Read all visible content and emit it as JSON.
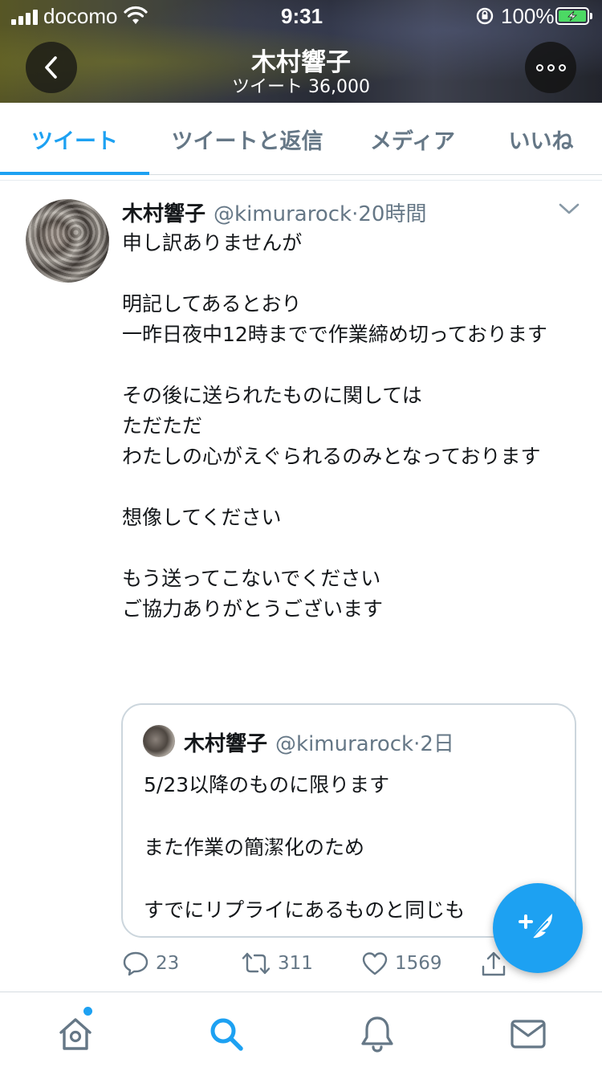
{
  "status_bar": {
    "carrier": "docomo",
    "time": "9:31",
    "battery": "100%"
  },
  "header": {
    "title": "木村響子",
    "tweet_count": "ツイート 36,000"
  },
  "tabs": [
    {
      "label": "ツイート",
      "active": true
    },
    {
      "label": "ツイートと返信",
      "active": false
    },
    {
      "label": "メディア",
      "active": false
    },
    {
      "label": "いいね",
      "active": false
    }
  ],
  "tweet": {
    "name": "木村響子",
    "handle": "@kimurarock",
    "separator": "·",
    "time": "20時間",
    "text": "申し訳ありませんが\n\n明記してあるとおり\n一昨日夜中12時までで作業締め切っております\n\nその後に送られたものに関しては\nただただ\nわたしの心がえぐられるのみとなっております\n\n想像してください\n\nもう送ってこないでください\nご協力ありがとうございます",
    "quote": {
      "name": "木村響子",
      "handle": "@kimurarock",
      "separator": "·",
      "time": "2日",
      "text": "5/23以降のものに限ります\n\nまた作業の簡潔化のため\n\nすでにリプライにあるものと同じも"
    },
    "replies": "23",
    "retweets": "311",
    "likes": "1569"
  },
  "colors": {
    "accent": "#1da1f2",
    "secondary_text": "#657786",
    "primary_text": "#14171a"
  },
  "icons": {
    "back": "chevron-left-icon",
    "more": "more-icon",
    "reply": "reply-icon",
    "retweet": "retweet-icon",
    "like": "heart-icon",
    "share": "share-icon",
    "compose": "compose-icon",
    "home": "home-icon",
    "search": "search-icon",
    "notifications": "bell-icon",
    "messages": "mail-icon"
  }
}
